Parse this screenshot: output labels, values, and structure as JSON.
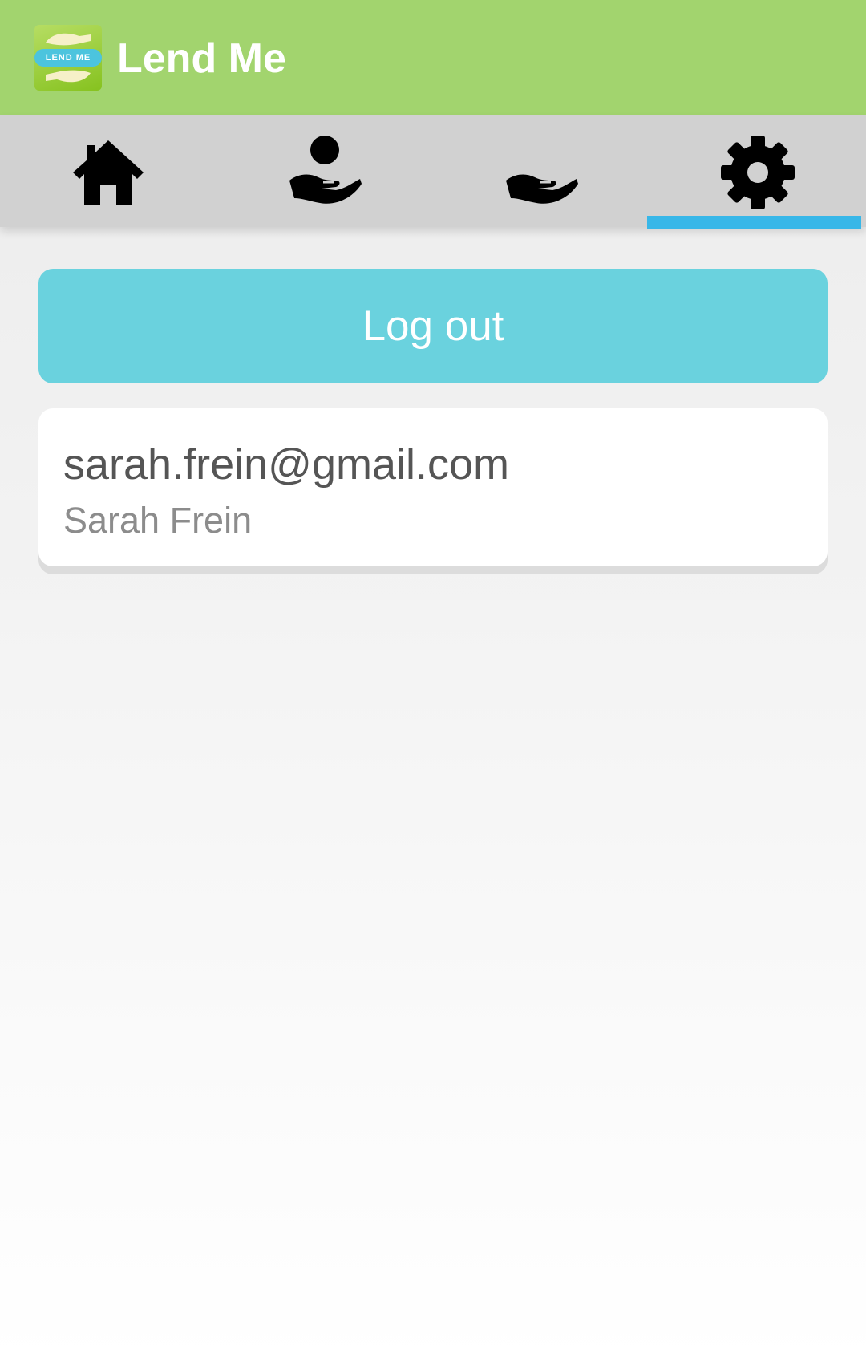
{
  "app_bar": {
    "title": "Lend Me",
    "logo_text": "LEND ME",
    "background_color": "#a2d46e"
  },
  "tabs": [
    {
      "name": "home",
      "icon": "home-icon",
      "selected": false
    },
    {
      "name": "borrow",
      "icon": "hand-receive-icon",
      "selected": false
    },
    {
      "name": "lend",
      "icon": "hand-give-icon",
      "selected": false
    },
    {
      "name": "settings",
      "icon": "gear-icon",
      "selected": true
    }
  ],
  "tab_indicator_color": "#38b7e8",
  "logout_button": {
    "label": "Log out",
    "color": "#6ad2de"
  },
  "account": {
    "email": "sarah.frein@gmail.com",
    "name": "Sarah Frein"
  }
}
